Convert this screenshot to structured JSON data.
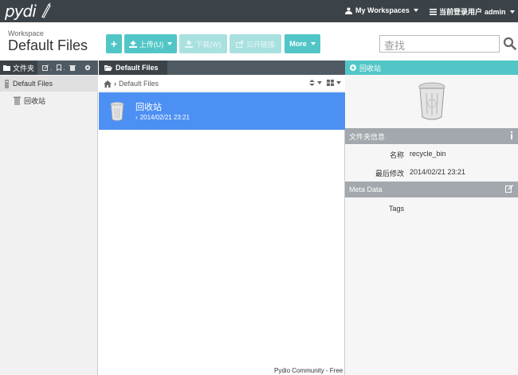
{
  "app": {
    "logo": "pydi"
  },
  "topnav": {
    "workspaces": "My Workspaces",
    "user_prefix": "当前登录用户",
    "user_name": "admin"
  },
  "header": {
    "workspace_label": "Workspace",
    "title": "Default Files"
  },
  "toolbar": {
    "add_label": "+",
    "upload_label": "上传(U)",
    "download_label": "下载(W)",
    "share_label": "公开链接",
    "more_label": "More"
  },
  "search": {
    "placeholder": "查找"
  },
  "left_panel": {
    "tab_label": "文件夹",
    "tree": [
      {
        "label": "Default Files"
      },
      {
        "label": "回收站"
      }
    ]
  },
  "middle": {
    "tab_label": "Default Files",
    "breadcrumb": "Default Files",
    "files": [
      {
        "name": "回收站",
        "modified": "2014/02/21 23:21"
      }
    ],
    "footer": "Pydio Community - Free r"
  },
  "right_panel": {
    "header": "回收站",
    "folder_info_title": "文件夹信息",
    "info": [
      {
        "key": "名称",
        "value": "recycle_bin"
      },
      {
        "key": "最后修改",
        "value": "2014/02/21 23:21"
      }
    ],
    "meta_title": "Meta Data",
    "meta": [
      {
        "key": "Tags",
        "value": ""
      }
    ]
  },
  "colors": {
    "topbar": "#3c4348",
    "accent": "#52c6c7",
    "selection": "#4d90f4",
    "section": "#a2a8ad"
  }
}
